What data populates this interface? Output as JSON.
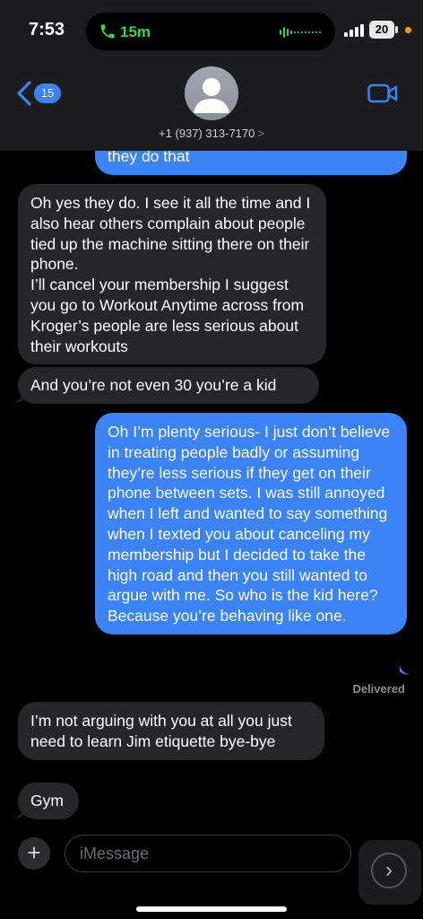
{
  "status": {
    "time": "7:53",
    "call_duration": "15m",
    "battery": "20"
  },
  "header": {
    "back_count": "15",
    "contact": "+1 (937) 313-7170",
    "contact_chevron": ">"
  },
  "messages": [
    {
      "direction": "outgoing",
      "text": "they do that"
    },
    {
      "direction": "incoming",
      "text": "Oh yes they do. I see it all the time and I also hear others complain about people tied up the machine sitting there on their phone.\nI’ll cancel your membership I suggest you go to Workout Anytime across from Kroger’s people are less serious about their workouts"
    },
    {
      "direction": "incoming",
      "text": "And you’re not even 30 you’re a kid"
    },
    {
      "direction": "outgoing",
      "text": "Oh I’m plenty serious- I just don’t believe in treating people badly or assuming they’re less serious if they get on their phone between sets. I was still annoyed when I left and wanted to say something when I texted you about canceling my membership but I decided to take the high road and then you still wanted to argue with me. So who is the kid here? Because you’re behaving like one."
    },
    {
      "direction": "incoming",
      "text": "I’m not arguing with you at all you just need to learn Jim etiquette bye-bye"
    },
    {
      "direction": "incoming",
      "text": "Gym"
    }
  ],
  "delivered_label": "Delivered",
  "input": {
    "placeholder": "iMessage",
    "plus": "+",
    "send": "›"
  },
  "colors": {
    "outgoing_bubble": "#3b83f6",
    "incoming_bubble": "#262628",
    "call_green": "#3ad05a"
  },
  "icons": [
    "phone-icon",
    "voice-wave-icon",
    "signal-icon",
    "battery-icon",
    "back-chevron-icon",
    "avatar-icon",
    "video-camera-icon",
    "plus-icon",
    "send-arrow-icon"
  ]
}
